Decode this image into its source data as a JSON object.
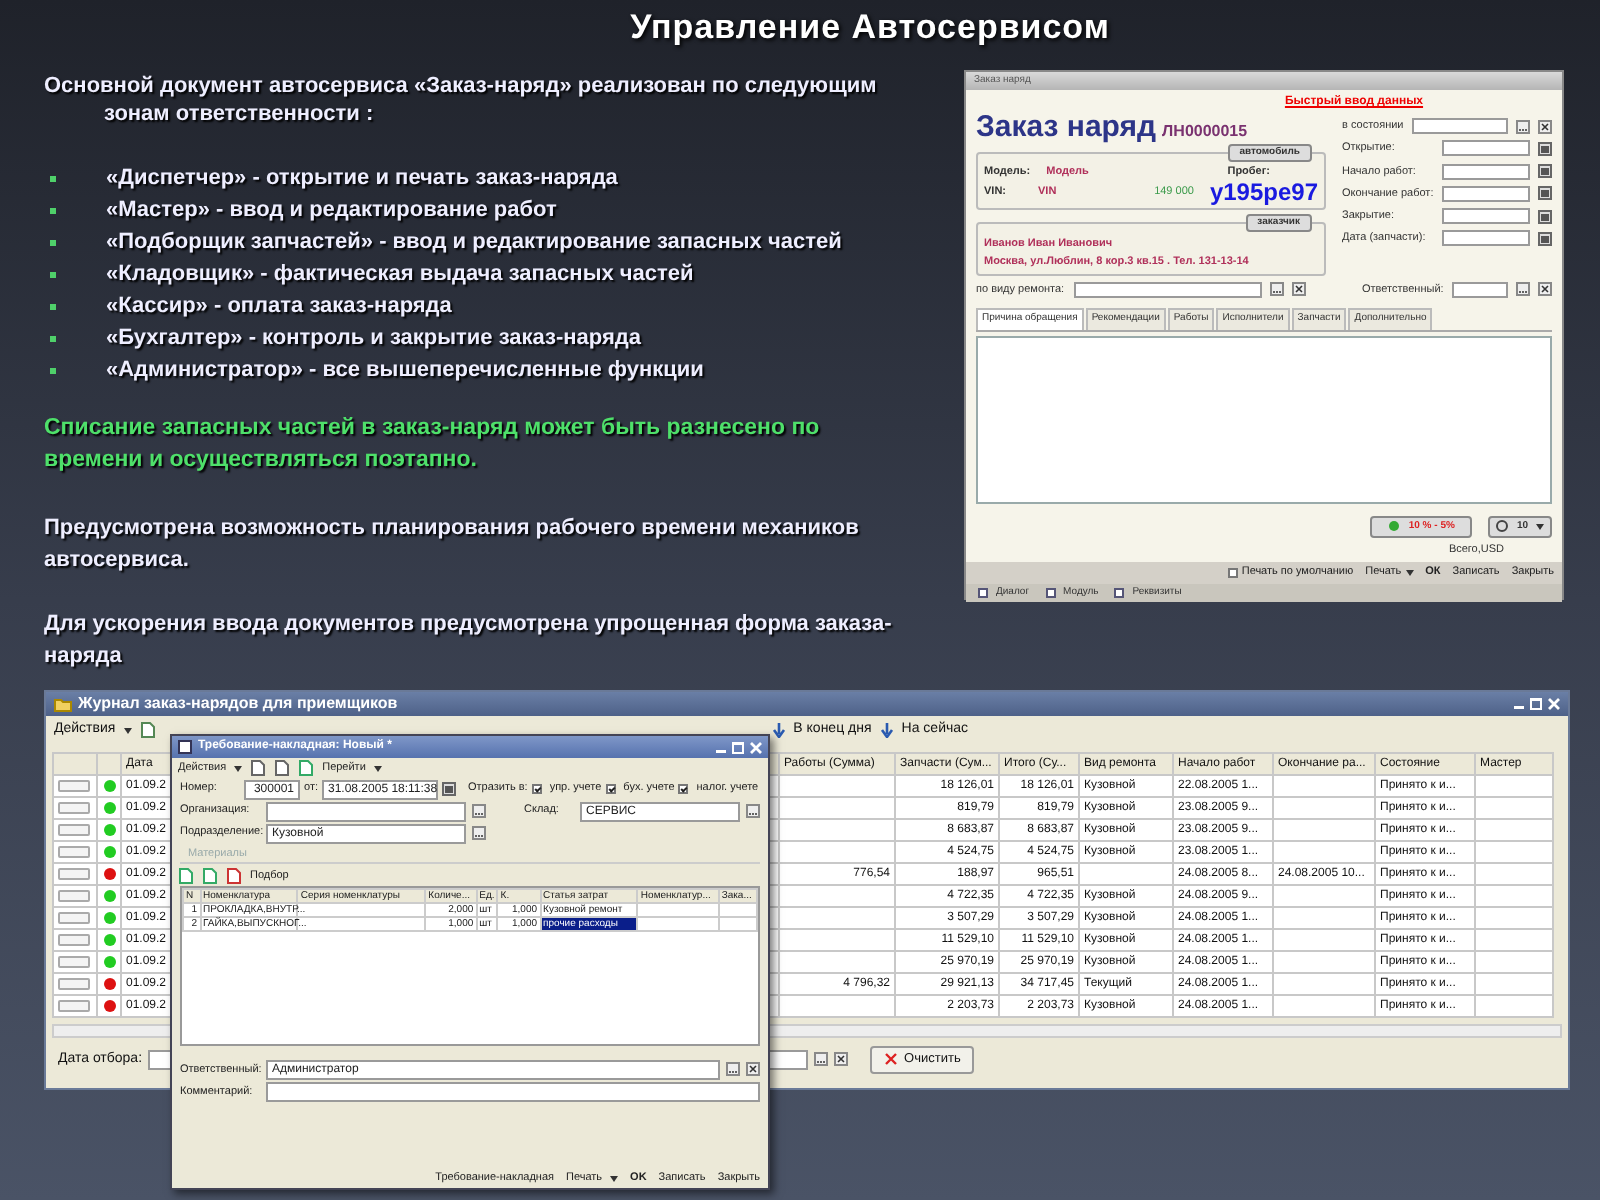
{
  "title": "Управление Автосервисом",
  "intro": "Основной документ автосервиса «Заказ-наряд» реализован по следующим зонам ответственности :",
  "roles": [
    "«Диспетчер» - открытие и печать заказ-наряда",
    "«Мастер» - ввод и редактирование работ",
    "«Подборщик запчастей» - ввод и редактирование запасных частей",
    "«Кладовщик» - фактическая выдача запасных частей",
    "«Кассир» - оплата заказ-наряда",
    "«Бухгалтер» - контроль и закрытие заказ-наряда",
    "«Администратор» - все вышеперечисленные функции"
  ],
  "highlight": "Списание запасных частей в заказ-наряд может быть разнесено по времени и осуществляться поэтапно.",
  "paragraphs": [
    "Предусмотрена возможность планирования рабочего времени механиков автосервиса.",
    "Для ускорения ввода документов предусмотрена упрощенная форма заказа-наряда"
  ],
  "order_form": {
    "window_title": "Заказ наряд",
    "quick_entry": "Быстрый ввод данных",
    "heading": "Заказ наряд",
    "number": "ЛН0000015",
    "state_label": "в состоянии",
    "car_button": "автомобиль",
    "model_label": "Модель:",
    "model": "Модель",
    "mileage_label": "Пробег:",
    "vin_label": "VIN:",
    "vin": "VIN",
    "mileage": "149 000",
    "plate": "у195ре97",
    "customer_button": "заказчик",
    "customer_name": "Иванов Иван Иванович",
    "customer_address": "Москва, ул.Люблин, 8 кор.3 кв.15 . Тел. 131-13-14",
    "date_fields": [
      "Открытие:",
      "Начало работ:",
      "Окончание работ:",
      "Закрытие:",
      "Дата (запчасти):"
    ],
    "repair_label": "по виду ремонта:",
    "responsible_label": "Ответственный:",
    "tabs": [
      {
        "label": "Причина обращения",
        "selected": true
      },
      {
        "label": "Рекомендации",
        "selected": false
      },
      {
        "label": "Работы",
        "selected": false
      },
      {
        "label": "Исполнители",
        "selected": false
      },
      {
        "label": "Запчасти",
        "selected": false
      },
      {
        "label": "Дополнительно",
        "selected": false
      }
    ],
    "discount": "10 % - 5%",
    "rounding": "10",
    "total_label": "Всего,USD",
    "buttons": [
      {
        "label": "Печать по умолчанию",
        "kind": "check"
      },
      {
        "label": "Печать",
        "kind": "menu"
      },
      {
        "label": "ОК",
        "kind": "default"
      },
      {
        "label": "Записать",
        "kind": "plain"
      },
      {
        "label": "Закрыть",
        "kind": "plain"
      }
    ],
    "taskbar": [
      "Диалог",
      "Модуль",
      "Реквизиты"
    ]
  },
  "journal": {
    "title": "Журнал заказ-нарядов для приемщиков",
    "toolbar": [
      {
        "label": "Действия",
        "kind": "menu"
      },
      {
        "label": "В конец дня",
        "kind": "icon"
      },
      {
        "label": "На сейчас",
        "kind": "icon"
      }
    ],
    "left_columns": [
      "Дата"
    ],
    "columns": [
      "Работы (Сумма)",
      "Запчасти (Сум...",
      "Итого (Су...",
      "Вид ремонта",
      "Начало работ",
      "Окончание ра...",
      "Состояние",
      "Мастер"
    ],
    "rows": [
      {
        "color": "#22cc22",
        "date": "01.09.2",
        "cells": [
          "",
          "18 126,01",
          "18 126,01",
          "Кузовной",
          "22.08.2005 1...",
          "",
          "Принято к и...",
          ""
        ]
      },
      {
        "color": "#22cc22",
        "date": "01.09.2",
        "cells": [
          "",
          "819,79",
          "819,79",
          "Кузовной",
          "23.08.2005 9...",
          "",
          "Принято к и...",
          ""
        ]
      },
      {
        "color": "#22cc22",
        "date": "01.09.2",
        "cells": [
          "",
          "8 683,87",
          "8 683,87",
          "Кузовной",
          "23.08.2005 9...",
          "",
          "Принято к и...",
          ""
        ]
      },
      {
        "color": "#22cc22",
        "date": "01.09.2",
        "cells": [
          "",
          "4 524,75",
          "4 524,75",
          "Кузовной",
          "23.08.2005 1...",
          "",
          "Принято к и...",
          ""
        ]
      },
      {
        "color": "#dd1111",
        "date": "01.09.2",
        "cells": [
          "776,54",
          "188,97",
          "965,51",
          "",
          "24.08.2005 8...",
          "24.08.2005 10...",
          "Принято к и...",
          ""
        ]
      },
      {
        "color": "#22cc22",
        "date": "01.09.2",
        "cells": [
          "",
          "4 722,35",
          "4 722,35",
          "Кузовной",
          "24.08.2005 9...",
          "",
          "Принято к и...",
          ""
        ]
      },
      {
        "color": "#22cc22",
        "date": "01.09.2",
        "cells": [
          "",
          "3 507,29",
          "3 507,29",
          "Кузовной",
          "24.08.2005 1...",
          "",
          "Принято к и...",
          ""
        ]
      },
      {
        "color": "#22cc22",
        "date": "01.09.2",
        "cells": [
          "",
          "11 529,10",
          "11 529,10",
          "Кузовной",
          "24.08.2005 1...",
          "",
          "Принято к и...",
          ""
        ]
      },
      {
        "color": "#22cc22",
        "date": "01.09.2",
        "cells": [
          "",
          "25 970,19",
          "25 970,19",
          "Кузовной",
          "24.08.2005 1...",
          "",
          "Принято к и...",
          ""
        ]
      },
      {
        "color": "#dd1111",
        "date": "01.09.2",
        "cells": [
          "4 796,32",
          "29 921,13",
          "34 717,45",
          "Текущий",
          "24.08.2005 1...",
          "",
          "Принято к и...",
          ""
        ]
      },
      {
        "color": "#dd1111",
        "date": "01.09.2",
        "cells": [
          "",
          "2 203,73",
          "2 203,73",
          "Кузовной",
          "24.08.2005 1...",
          "",
          "Принято к и...",
          ""
        ]
      }
    ],
    "filter_label": "Дата отбора:",
    "clear_button": "Очистить"
  },
  "requisition": {
    "title": "Требование-накладная: Новый *",
    "toolbar": [
      {
        "label": "Действия",
        "kind": "menu"
      },
      {
        "label": "Перейти",
        "kind": "menu"
      }
    ],
    "number_label": "Номер:",
    "number": "300001",
    "date_label": "от:",
    "date": "31.08.2005 18:11:38",
    "reflect_label": "Отразить в:",
    "reflect": [
      {
        "label": "упр. учете",
        "checked": true
      },
      {
        "label": "бух. учете",
        "checked": true
      },
      {
        "label": "налог. учете",
        "checked": true
      }
    ],
    "org_label": "Организация:",
    "warehouse_label": "Склад:",
    "warehouse": "СЕРВИС",
    "dept_label": "Подразделение:",
    "dept": "Кузовной",
    "section": "Материалы",
    "pick": "Подбор",
    "columns": [
      "N",
      "Номенклатура",
      "Серия номенклатуры",
      "Количе...",
      "Ед.",
      "К.",
      "Статья затрат",
      "Номенклатур...",
      "Зака..."
    ],
    "rows": [
      {
        "cells": [
          "1",
          "ПРОКЛАДКА,ВНУТР...",
          "",
          "2,000",
          "шт",
          "1,000",
          "Кузовной ремонт",
          "",
          ""
        ],
        "selected": false
      },
      {
        "cells": [
          "2",
          "ГАЙКА,ВЫПУСКНОГ...",
          "",
          "1,000",
          "шт",
          "1,000",
          "прочие расходы",
          "",
          ""
        ],
        "selected": true
      }
    ],
    "responsible_label": "Ответственный:",
    "responsible": "Администратор",
    "comment_label": "Комментарий:",
    "buttons": [
      {
        "label": "Требование-накладная",
        "kind": "plain"
      },
      {
        "label": "Печать",
        "kind": "menu"
      },
      {
        "label": "OK",
        "kind": "default"
      },
      {
        "label": "Записать",
        "kind": "plain"
      },
      {
        "label": "Закрыть",
        "kind": "plain"
      }
    ]
  }
}
